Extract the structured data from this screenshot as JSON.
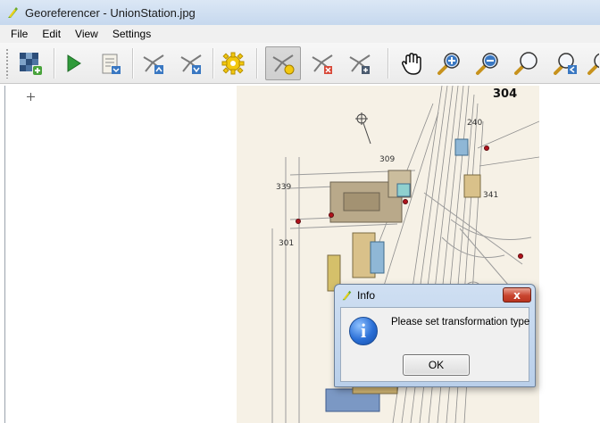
{
  "window": {
    "title": "Georeferencer - UnionStation.jpg",
    "icon": "qgis-logo-icon"
  },
  "menu": {
    "items": [
      "File",
      "Edit",
      "View",
      "Settings"
    ]
  },
  "toolbar": {
    "buttons": [
      {
        "name": "open-raster-button",
        "icon": "open-raster-icon"
      },
      {
        "name": "start-georeferencing-button",
        "icon": "play-icon"
      },
      {
        "name": "generate-script-button",
        "icon": "script-icon"
      },
      {
        "name": "load-gcp-points-button",
        "icon": "load-points-icon"
      },
      {
        "name": "save-gcp-points-button",
        "icon": "save-points-icon"
      },
      {
        "name": "transformation-settings-button",
        "icon": "gear-icon"
      },
      {
        "name": "add-point-button",
        "icon": "add-point-icon",
        "pressed": true
      },
      {
        "name": "delete-point-button",
        "icon": "delete-point-icon"
      },
      {
        "name": "move-gcp-point-button",
        "icon": "move-point-icon"
      },
      {
        "name": "pan-button",
        "icon": "hand-icon"
      },
      {
        "name": "zoom-in-button",
        "icon": "zoom-in-icon"
      },
      {
        "name": "zoom-out-button",
        "icon": "zoom-out-icon"
      },
      {
        "name": "zoom-to-layer-button",
        "icon": "zoom-full-icon"
      },
      {
        "name": "zoom-last-button",
        "icon": "zoom-last-icon"
      }
    ]
  },
  "map": {
    "sheet_number": "304",
    "labels": [
      "240",
      "339",
      "341",
      "301",
      "309"
    ],
    "gcp_color": "#b0121b"
  },
  "dialog": {
    "title": "Info",
    "message": "Please set transformation type",
    "ok_label": "OK",
    "close_label": "x",
    "icon": "info-icon"
  }
}
